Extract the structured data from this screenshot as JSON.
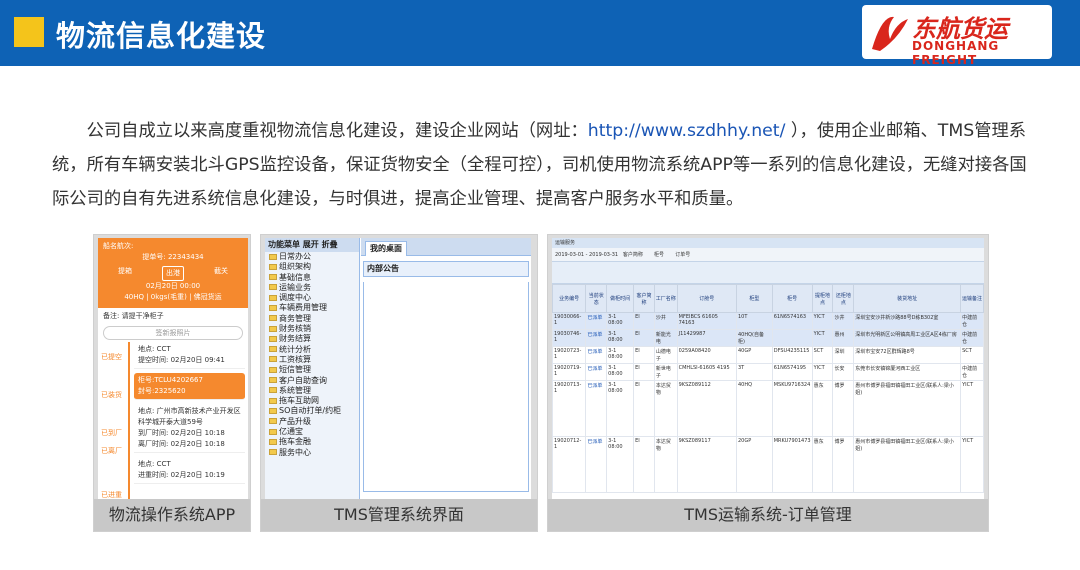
{
  "header": {
    "title": "物流信息化建设",
    "logo_cn": "东航货运",
    "logo_en": "DONGHANG FREIGHT",
    "accent": "#f4c41b",
    "bg": "#0e62b5"
  },
  "intro": {
    "before": "公司自成立以来高度重视物流信息化建设，建设企业网站（网址：",
    "link": "http://www.szdhhy.net/",
    "after": " ），使用企业邮箱、TMS管理系统，所有车辆安装北斗GPS监控设备，保证货物安全（全程可控），司机使用物流系统APP等一系列的信息化建设，无缝对接各国际公司的自有先进系统信息化建设，与时俱进，提高企业管理、提高客户服务水平和质量。"
  },
  "captions": {
    "app": "物流操作系统APP",
    "tms": "TMS管理系统界面",
    "order": "TMS运输系统-订单管理"
  },
  "app": {
    "order_label": "船名航次:",
    "order_no": "提单号: 22343434",
    "pickup": "提箱",
    "port": "出港",
    "return": "截关",
    "date": "02月20日 00:00",
    "container": "40HQ | 0kgs(毛重) | 佛冠货运",
    "remark": "备注: 请提干净柜子",
    "sign_btn": "签新报照片",
    "stages": [
      "已提空",
      "已装货",
      "已到厂",
      "已离厂",
      "已进重"
    ],
    "cards": [
      {
        "l1": "地点: CCT",
        "l2": "提空时间: 02月20日 09:41"
      },
      {
        "l1": "柜号:TCLU4202667",
        "l2": "封号:2325620"
      },
      {
        "l1": "地点: 广州市高新技术产业开发区科学城开泰大道59号",
        "l2": "到厂时间: 02月20日 10:18",
        "l3": "离厂时间: 02月20日 10:18"
      },
      {
        "l1": "地点: CCT",
        "l2": "进重时间: 02月20日 10:19"
      }
    ]
  },
  "tms": {
    "side_header": "功能菜单 展开 折叠",
    "tab": "我的桌面",
    "notice": "内部公告",
    "menu": [
      "日常办公",
      "组织架构",
      "基础信息",
      "运输业务",
      "调度中心",
      "车辆费用管理",
      "商务管理",
      "财务核销",
      "财务结算",
      "统计分析",
      "工资核算",
      "短信管理",
      "客户自助查询",
      "系统管理",
      "拖车互助网",
      "SO自动打单/约柜",
      "产品升级",
      "亿通宝",
      "拖车金融",
      "服务中心"
    ]
  },
  "order": {
    "bar1": "运输服务",
    "date_from": "2019-03-01",
    "date_to": "2019-03-31",
    "customer_label": "客户简称",
    "container_label": "柜号",
    "order_label": "订单号",
    "columns": [
      "业务编号",
      "当前状态",
      "做柜时间",
      "客户简称",
      "工厂名称",
      "订舱号",
      "柜型",
      "柜号",
      "提柜地点",
      "还柜地点",
      "装货地址",
      "运输备注"
    ],
    "rows": [
      [
        "19030066-1",
        "已派单",
        "3-1 08:00",
        "EI",
        "沙井",
        "MFEIBCS 61605 74163",
        "10T",
        "61N6574163",
        "YICT",
        "沙井",
        "深圳宝安沙井新沙路88号D栋B302室",
        "中建前仓"
      ],
      [
        "19030746-1",
        "已派单",
        "3-1 08:00",
        "EI",
        "新能光电",
        "J11429987",
        "40HQ(自备柜)",
        "",
        "YICT",
        "惠州",
        "深圳市光明新区公明镇高周工业区A区4栋厂房",
        "中建前仓"
      ],
      [
        "19020723-1",
        "已派单",
        "3-1 08:00",
        "EI",
        "山德电子",
        "0259A08420",
        "40GP",
        "DFSU4235115",
        "SCT",
        "深圳",
        "深圳市宝安72区群辉路8号",
        "SCT"
      ],
      [
        "19020719-1",
        "已派单",
        "3-1 08:00",
        "EI",
        "新世电子",
        "CMHLSI-61605 4195",
        "3T",
        "61N6574195",
        "YICT",
        "长安",
        "东莞市长安镇锦厦河西工业区",
        "中建前仓"
      ],
      [
        "19020713-1",
        "已派单",
        "3-1 08:00",
        "EI",
        "本达贸物",
        "9KSZ089112",
        "40HQ",
        "MSKU9716324",
        "惠东",
        "博罗",
        "惠州市博罗县福田镇福田工业区(联系人:梁小姐)",
        "YICT"
      ],
      [
        "19020712-1",
        "已派单",
        "3-1 08:00",
        "EI",
        "本达贸物",
        "9KSZ089117",
        "20GP",
        "MRKU7901473",
        "惠东",
        "博罗",
        "惠州市博罗县福田镇福田工业区(联系人:梁小姐)",
        "YICT"
      ]
    ]
  }
}
